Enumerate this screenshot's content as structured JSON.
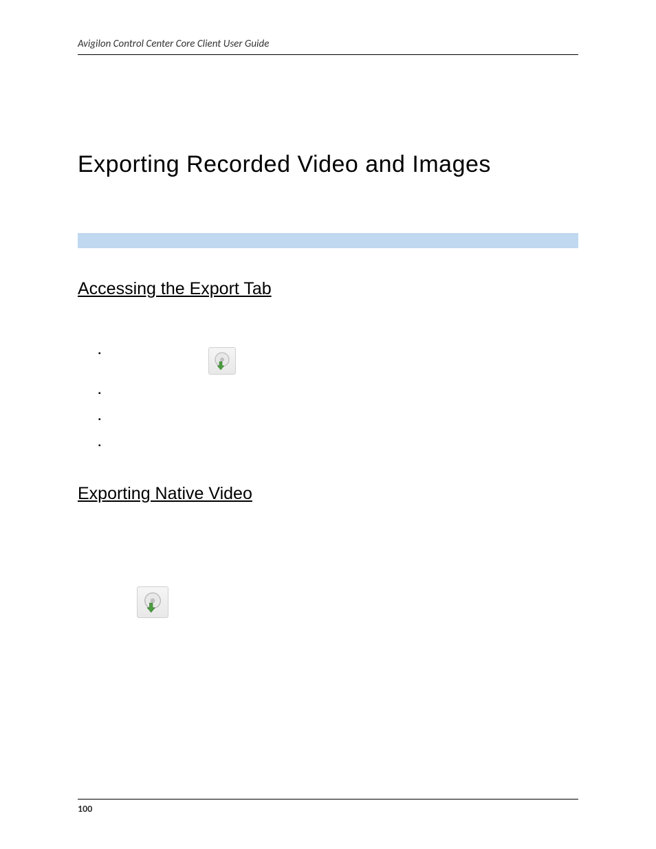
{
  "header": {
    "text": "Avigilon Control Center Core Client User Guide"
  },
  "main_title": "Exporting Recorded Video and Images",
  "section_1": {
    "title": "Accessing the Export Tab"
  },
  "section_2": {
    "title": "Exporting Native Video"
  },
  "footer": {
    "page_number": "100"
  }
}
